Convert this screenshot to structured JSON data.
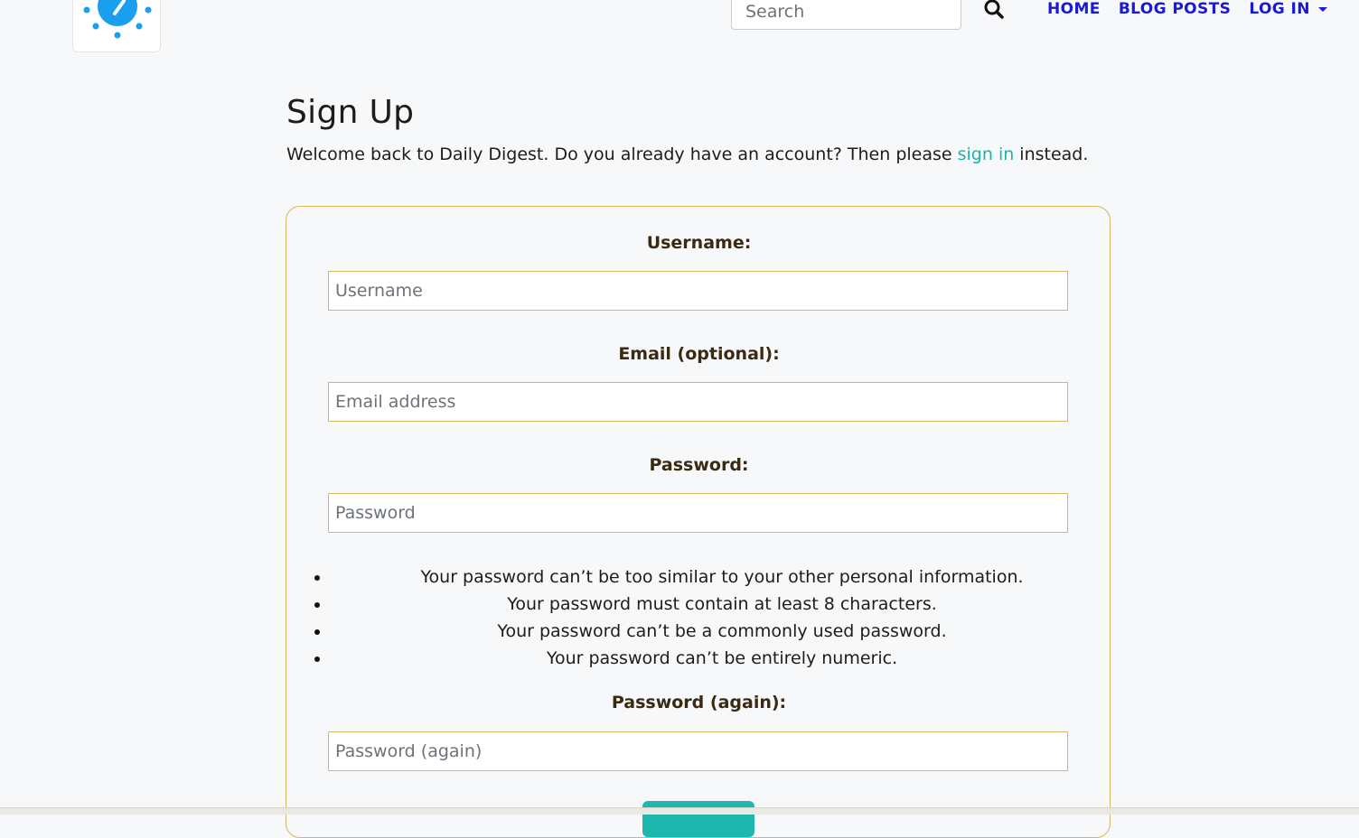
{
  "header": {
    "logo_icon": "sun-icon",
    "logo_color": "#1a9fef",
    "search": {
      "placeholder": "Search",
      "value": ""
    },
    "search_icon": "search-icon",
    "nav": {
      "home": "HOME",
      "blog_posts": "BLOG POSTS",
      "log_in": "LOG IN"
    },
    "nav_color": "#1a1ad6"
  },
  "page": {
    "title": "Sign Up",
    "intro_before": "Welcome back to Daily Digest. Do you already have an account? Then please ",
    "intro_link": "sign in",
    "intro_after": " instead."
  },
  "form": {
    "username_label": "Username:",
    "username_placeholder": "Username",
    "email_label": "Email (optional):",
    "email_placeholder": "Email address",
    "password_label": "Password:",
    "password_placeholder": "Password",
    "password_help": [
      "Your password can’t be too similar to your other personal information.",
      "Your password must contain at least 8 characters.",
      "Your password can’t be a commonly used password.",
      "Your password can’t be entirely numeric."
    ],
    "password2_label": "Password (again):",
    "password2_placeholder": "Password (again)",
    "border_color": "#d6b661",
    "submit_color": "#1eb7b0"
  },
  "link_color": "#20b2aa"
}
